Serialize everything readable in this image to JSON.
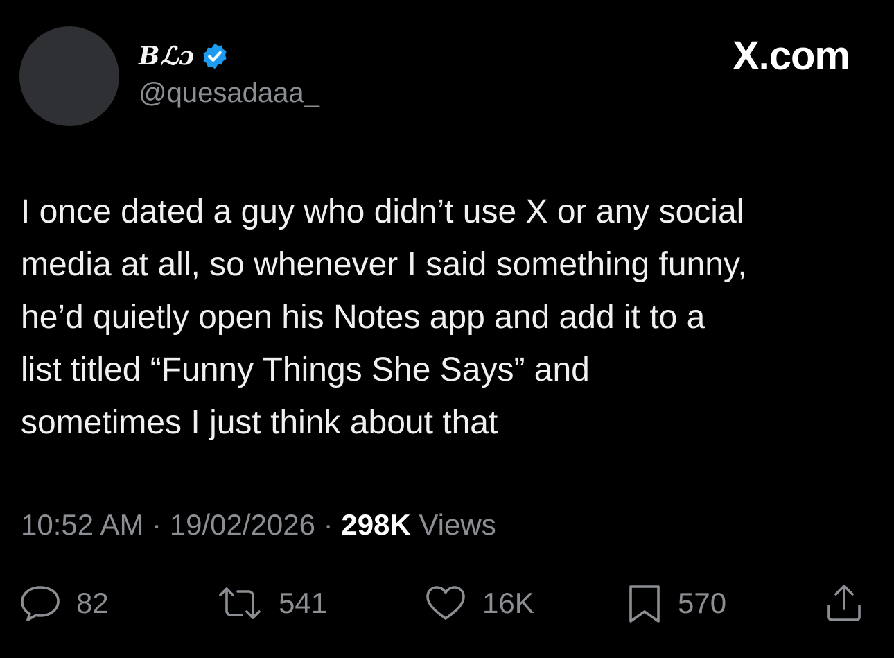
{
  "author": {
    "display_name": "Bℒɔ",
    "handle": "@quesadaaa_",
    "verified": true
  },
  "brand": "X.com",
  "tweet": {
    "lines": [
      "I once dated a guy who didn’t use X or any social",
      "media at all, so whenever I said something funny,",
      "he’d quietly open his Notes app and add it to a",
      "list titled “Funny Things She Says” and",
      "sometimes I just think about that"
    ]
  },
  "meta": {
    "time": "10:52 AM",
    "separator": " · ",
    "date": "19/02/2026",
    "views_count": "298K",
    "views_label": " Views"
  },
  "actions": {
    "replies": "82",
    "reposts": "541",
    "likes": "16K",
    "bookmarks": "570"
  },
  "icons": {
    "reply": "reply-icon",
    "repost": "repost-icon",
    "like": "heart-icon",
    "bookmark": "bookmark-icon",
    "share": "share-icon",
    "verified": "verified-badge-icon"
  },
  "colors": {
    "background": "#000000",
    "text": "#f0f0f0",
    "muted": "#8b8f94",
    "verified": "#1d9bf0"
  }
}
